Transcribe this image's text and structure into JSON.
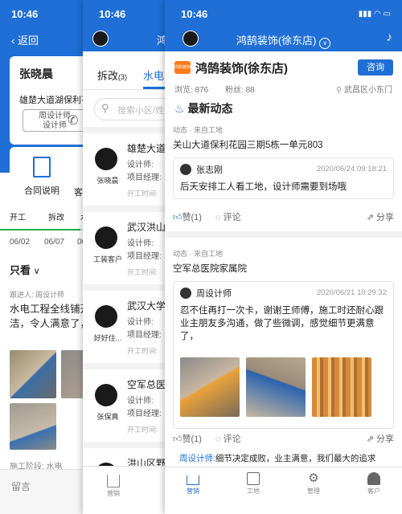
{
  "statusbar": {
    "time": "10:46"
  },
  "panel1": {
    "back_label": "返回",
    "client_name": "张晓晨",
    "address": "雄楚大道湖保利花园",
    "designer_box": {
      "line1": "周设计师",
      "line2": "设计师"
    },
    "contract_label": "合同说明",
    "contract_cut": "客",
    "tabs": [
      "开工",
      "拆改",
      "水"
    ],
    "dates": [
      "06/02",
      "06/07",
      "06"
    ],
    "only_view": "只看",
    "follower": "跟进人: 周设计师",
    "message": "水电工程全线铺开，工地干净整洁，令人满意了，",
    "stage": "施工阶段: 水电",
    "comment_placeholder": "留言"
  },
  "panel2": {
    "tabs": [
      {
        "label": "拆改",
        "count": "(3)"
      },
      {
        "label": "水电"
      }
    ],
    "search_placeholder": "搜索小区/姓名",
    "rows": [
      {
        "person": "张晓晨",
        "title": "雄楚大道",
        "designer": "设计师:",
        "manager": "项目经理:",
        "start": "开工时间:"
      },
      {
        "person": "工装客户",
        "title": "武汉洪山",
        "designer": "设计师:",
        "manager": "项目经理:",
        "start": "开工时间:"
      },
      {
        "person": "好好住...",
        "title": "武汉大学",
        "designer": "设计师:",
        "manager": "项目经理:",
        "start": "开工时间:"
      },
      {
        "person": "张保真",
        "title": "空军总医",
        "designer": "设计师:",
        "manager": "项目经理:",
        "start": "开工时间:"
      },
      {
        "person": "",
        "title": "洪山区野",
        "designer": "",
        "manager": "",
        "start": ""
      }
    ],
    "header_cut": "鸿",
    "bottom_label": "营销"
  },
  "panel3": {
    "title": "鸿鹄装饰(徐东店)",
    "shop_name": "鸿鹄装饰(徐东店)",
    "logo_text": "鸿鹄装饰",
    "consult_label": "咨询",
    "views": "浏览: 876",
    "fans": "粉丝: 88",
    "location": "武昌区小东门",
    "latest_news": "最新动态",
    "posts": [
      {
        "tag": "动态 · 来自工地",
        "site": "关山大道保利花园三期5栋一单元803",
        "user": "张志刚",
        "time": "2020/06/24 09:18:21",
        "text": "后天安排工人看工地，设计师需要到场哦",
        "likes": "赞(1)",
        "comment": "评论",
        "share": "分享"
      },
      {
        "tag": "动态 · 来自工地",
        "site": "空军总医院家属院",
        "user": "周设计师",
        "time": "2020/06/21 10:29:32",
        "text": "忍不住再打一次卡，谢谢王师傅，施工时还耐心跟业主朋友多沟通，做了些微调，感觉细节更满意了，",
        "likes": "赞(1)",
        "comment": "评论",
        "share": "分享"
      }
    ],
    "quote_lead": "周设计师:",
    "quote_text": "细节决定成败，业主满意，我们最大的追求",
    "nav": [
      "营销",
      "工地",
      "管理",
      "客户"
    ]
  },
  "colors": {
    "primary": "#1f6fd6",
    "logo": "#ff7a1a"
  }
}
